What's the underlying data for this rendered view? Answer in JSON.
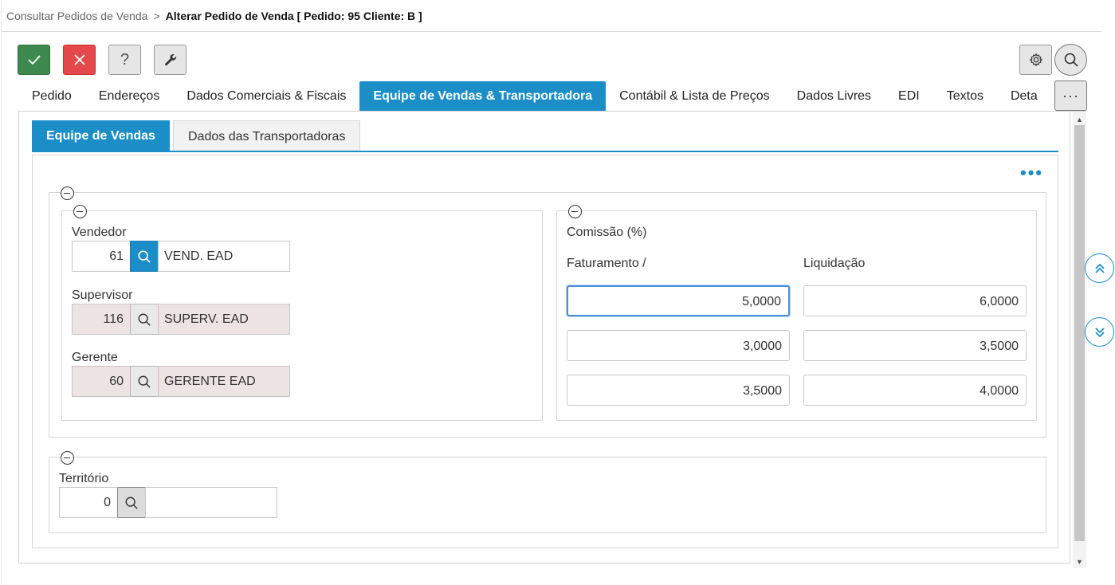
{
  "breadcrumb": {
    "parent": "Consultar Pedidos de Venda",
    "separator": ">",
    "current": "Alterar Pedido de Venda [ Pedido: 95 Cliente: B ]"
  },
  "toolbar": {
    "confirm_icon": "check-icon",
    "cancel_icon": "close-icon",
    "help_label": "?",
    "tools_icon": "wrench-icon",
    "settings_icon": "gear-icon",
    "search_icon": "search-icon"
  },
  "tabs": [
    {
      "label": "Pedido",
      "active": false
    },
    {
      "label": "Endereços",
      "active": false
    },
    {
      "label": "Dados Comerciais & Fiscais",
      "active": false
    },
    {
      "label": "Equipe de Vendas & Transportadora",
      "active": true
    },
    {
      "label": "Contábil & Lista de Preços",
      "active": false
    },
    {
      "label": "Dados Livres",
      "active": false
    },
    {
      "label": "EDI",
      "active": false
    },
    {
      "label": "Textos",
      "active": false
    },
    {
      "label": "Deta",
      "active": false
    }
  ],
  "more_tabs_label": "···",
  "subtabs": [
    {
      "label": "Equipe de Vendas",
      "active": true
    },
    {
      "label": "Dados das Transportadoras",
      "active": false
    }
  ],
  "options_label": "•••",
  "team": {
    "seller": {
      "label": "Vendedor",
      "code": "61",
      "name": "VEND. EAD"
    },
    "supervisor": {
      "label": "Supervisor",
      "code": "116",
      "name": "SUPERV. EAD"
    },
    "manager": {
      "label": "Gerente",
      "code": "60",
      "name": "GERENTE EAD"
    }
  },
  "commission": {
    "title": "Comissão (%)",
    "col_billing": "Faturamento /",
    "col_settlement": "Liquidação",
    "rows": [
      {
        "billing": "5,0000",
        "settlement": "6,0000"
      },
      {
        "billing": "3,0000",
        "settlement": "3,5000"
      },
      {
        "billing": "3,5000",
        "settlement": "4,0000"
      }
    ]
  },
  "territory": {
    "label": "Território",
    "code": "0",
    "name": ""
  },
  "colors": {
    "accent": "#1b8ec8",
    "confirm": "#3e8a4e",
    "cancel": "#e5484a"
  }
}
